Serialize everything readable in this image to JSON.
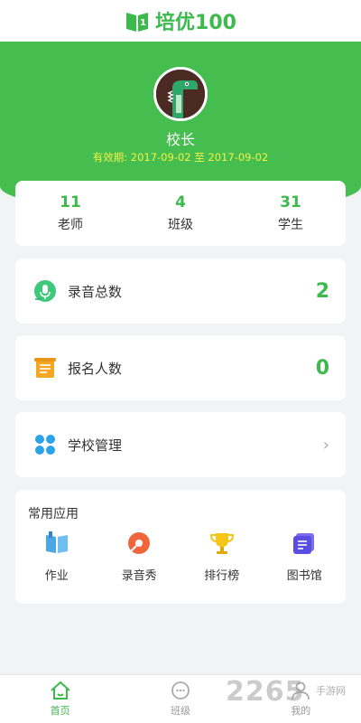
{
  "header": {
    "logo_text": "培优100"
  },
  "profile": {
    "name": "校长",
    "validity": "有效期: 2017-09-02 至 2017-09-02"
  },
  "stats": [
    {
      "value": "11",
      "label": "老师"
    },
    {
      "value": "4",
      "label": "班级"
    },
    {
      "value": "31",
      "label": "学生"
    }
  ],
  "rows": {
    "recordings": {
      "label": "录音总数",
      "value": "2"
    },
    "signups": {
      "label": "报名人数",
      "value": "0"
    },
    "school_mgmt": {
      "label": "学校管理",
      "chevron": "›"
    }
  },
  "apps": {
    "title": "常用应用",
    "items": [
      {
        "label": "作业",
        "icon": "homework-book-icon"
      },
      {
        "label": "录音秀",
        "icon": "recording-show-icon"
      },
      {
        "label": "排行榜",
        "icon": "trophy-icon"
      },
      {
        "label": "图书馆",
        "icon": "library-icon"
      }
    ]
  },
  "tabbar": {
    "items": [
      {
        "label": "首页",
        "active": true
      },
      {
        "label": "班级",
        "active": false
      },
      {
        "label": "我的",
        "active": false
      }
    ]
  },
  "watermark": {
    "text": "2265",
    "sub": "手游网"
  },
  "colors": {
    "primary": "#46be4f",
    "accent_text": "#3dba4e",
    "validity": "#f2f24a"
  }
}
